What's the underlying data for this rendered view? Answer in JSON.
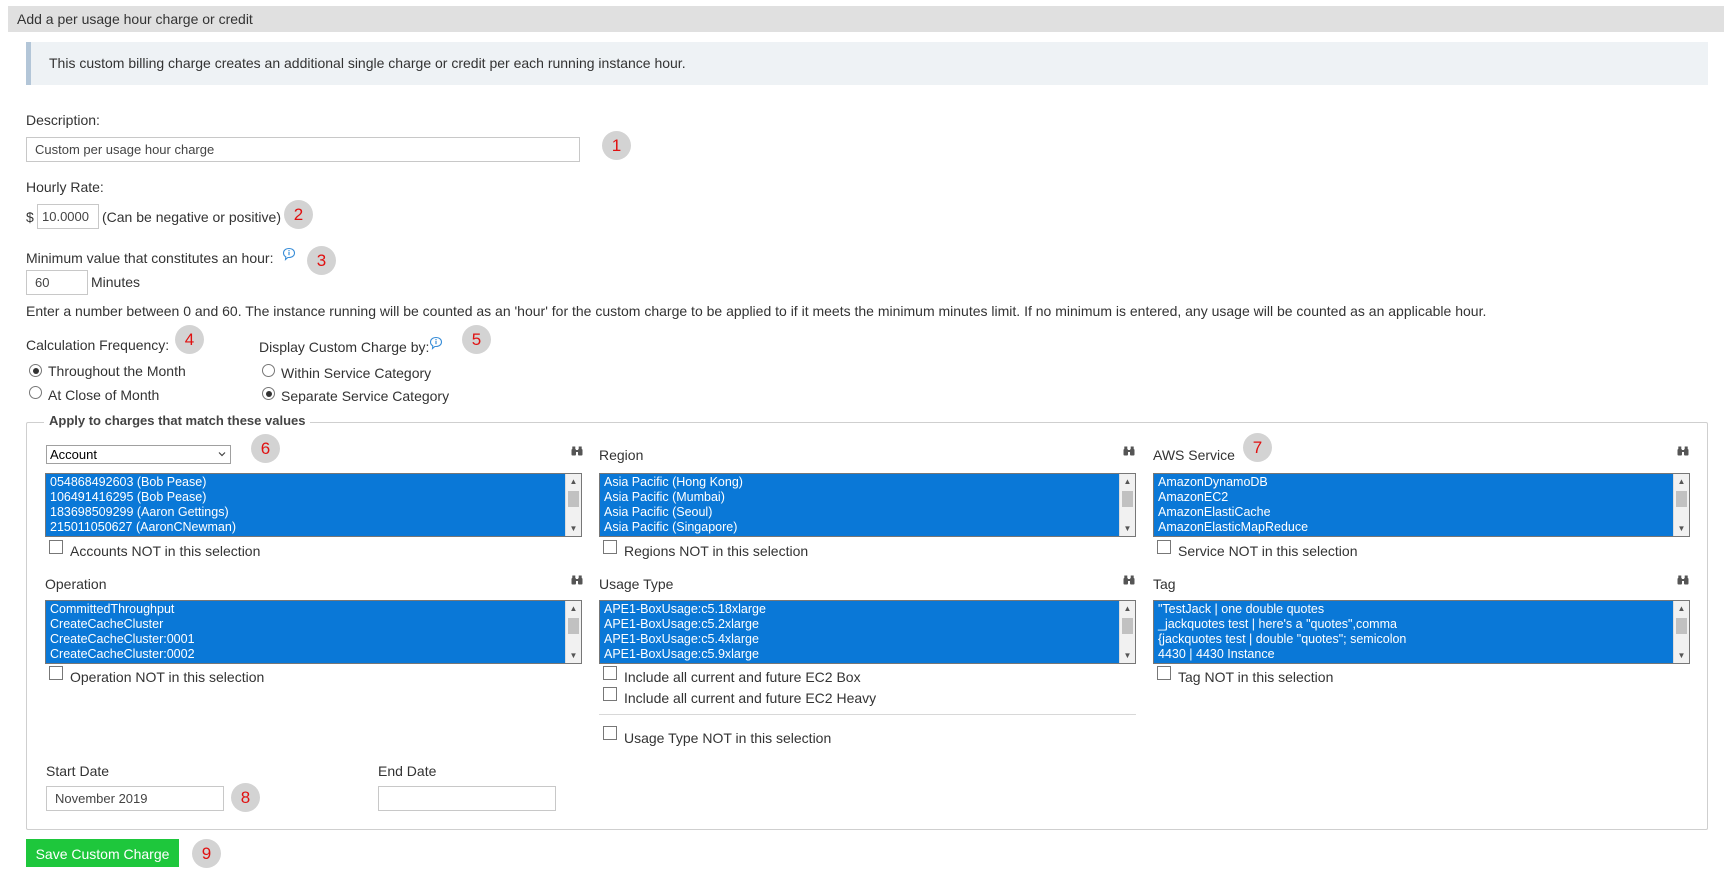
{
  "panel": {
    "title": "Add a per usage hour charge or credit"
  },
  "info": {
    "text": "This custom billing charge creates an additional single charge or credit per each running instance hour."
  },
  "description": {
    "label": "Description:",
    "value": "Custom per usage hour charge"
  },
  "hourly_rate": {
    "label": "Hourly Rate:",
    "currency": "$",
    "value": "10.0000",
    "hint": "(Can be negative or positive)"
  },
  "minimum": {
    "label": "Minimum value that constitutes an hour:",
    "value": "60",
    "unit": "Minutes",
    "help": "Enter a number between 0 and 60. The instance running will be counted as an 'hour' for the custom charge to be applied to if it meets the minimum minutes limit. If no minimum is entered, any usage will be counted as an applicable hour."
  },
  "calc_frequency": {
    "label": "Calculation Frequency:",
    "options": [
      {
        "label": "Throughout the Month",
        "checked": true
      },
      {
        "label": "At Close of Month",
        "checked": false
      }
    ]
  },
  "display_by": {
    "label": "Display Custom Charge by:",
    "options": [
      {
        "label": "Within Service Category",
        "checked": false
      },
      {
        "label": "Separate Service Category",
        "checked": true
      }
    ]
  },
  "filters": {
    "legend": "Apply to charges that match these values",
    "account": {
      "selected": "Account",
      "items": [
        "054868492603 (Bob Pease)",
        "106491416295 (Bob Pease)",
        "183698509299 (Aaron Gettings)",
        "215011050627 (AaronCNewman)"
      ],
      "not_label": "Accounts NOT in this selection"
    },
    "region": {
      "label": "Region",
      "items": [
        "Asia Pacific (Hong Kong)",
        "Asia Pacific (Mumbai)",
        "Asia Pacific (Seoul)",
        "Asia Pacific (Singapore)"
      ],
      "not_label": "Regions NOT in this selection"
    },
    "service": {
      "label": "AWS Service",
      "items": [
        "AmazonDynamoDB",
        "AmazonEC2",
        "AmazonElastiCache",
        "AmazonElasticMapReduce"
      ],
      "not_label": "Service NOT in this selection"
    },
    "operation": {
      "label": "Operation",
      "items": [
        "CommittedThroughput",
        "CreateCacheCluster",
        "CreateCacheCluster:0001",
        "CreateCacheCluster:0002"
      ],
      "not_label": "Operation NOT in this selection"
    },
    "usage_type": {
      "label": "Usage Type",
      "items": [
        "APE1-BoxUsage:c5.18xlarge",
        "APE1-BoxUsage:c5.2xlarge",
        "APE1-BoxUsage:c5.4xlarge",
        "APE1-BoxUsage:c5.9xlarge"
      ],
      "include_box": "Include all current and future EC2 Box",
      "include_heavy": "Include all current and future EC2 Heavy",
      "not_label": "Usage Type NOT in this selection"
    },
    "tag": {
      "label": "Tag",
      "items": [
        "\"TestJack | one double quotes",
        "_jackquotes test | here's a \"quotes\",comma",
        "{jackquotes test | double \"quotes\"; semicolon",
        "4430 | 4430 Instance"
      ],
      "not_label": "Tag NOT in this selection"
    }
  },
  "dates": {
    "start_label": "Start Date",
    "start_value": "November 2019",
    "end_label": "End Date",
    "end_value": ""
  },
  "save_button": "Save Custom Charge",
  "markers": [
    "1",
    "2",
    "3",
    "4",
    "5",
    "6",
    "7",
    "8",
    "9"
  ],
  "colors": {
    "selection": "#0a78d7",
    "save": "#1ec73c",
    "marker_text": "#e01010",
    "marker_bg": "#d3d3d3"
  }
}
